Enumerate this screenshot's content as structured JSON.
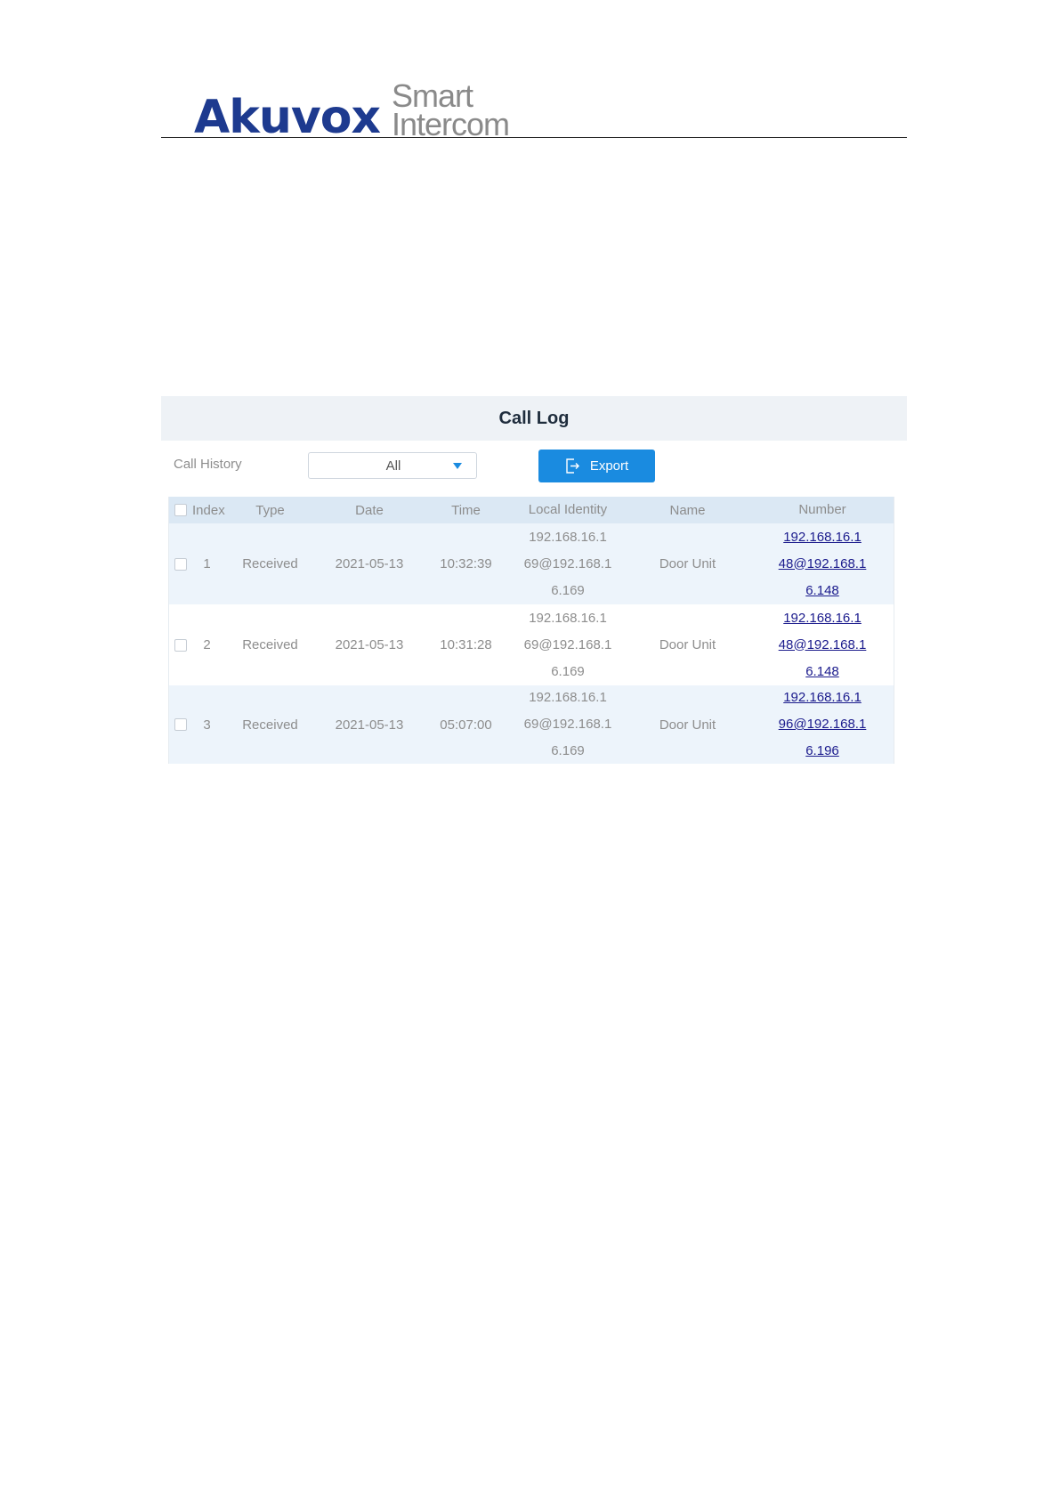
{
  "header": {
    "brand": "Akuvox",
    "tagline_line1": "Smart",
    "tagline_line2": "Intercom"
  },
  "panel": {
    "title": "Call Log",
    "filter_label": "Call History",
    "filter_selected": "All",
    "export_label": "Export"
  },
  "table": {
    "columns": [
      "Index",
      "Type",
      "Date",
      "Time",
      "Local Identity",
      "Name",
      "Number"
    ],
    "rows": [
      {
        "index": "1",
        "type": "Received",
        "date": "2021-05-13",
        "time": "10:32:39",
        "local_identity": [
          "192.168.16.1",
          "69@192.168.1",
          "6.169"
        ],
        "name": "Door Unit",
        "number": [
          "192.168.16.1",
          "48@192.168.1",
          "6.148"
        ]
      },
      {
        "index": "2",
        "type": "Received",
        "date": "2021-05-13",
        "time": "10:31:28",
        "local_identity": [
          "192.168.16.1",
          "69@192.168.1",
          "6.169"
        ],
        "name": "Door Unit",
        "number": [
          "192.168.16.1",
          "48@192.168.1",
          "6.148"
        ]
      },
      {
        "index": "3",
        "type": "Received",
        "date": "2021-05-13",
        "time": "05:07:00",
        "local_identity": [
          "192.168.16.1",
          "69@192.168.1",
          "6.169"
        ],
        "name": "Door Unit",
        "number": [
          "192.168.16.1",
          "96@192.168.1",
          "6.196"
        ]
      }
    ]
  },
  "colors": {
    "brand_blue": "#1d3a8f",
    "accent": "#1a8be0",
    "link": "#1a1a8c"
  },
  "icons": {
    "export": "export-icon",
    "dropdown": "chevron-down-icon"
  }
}
